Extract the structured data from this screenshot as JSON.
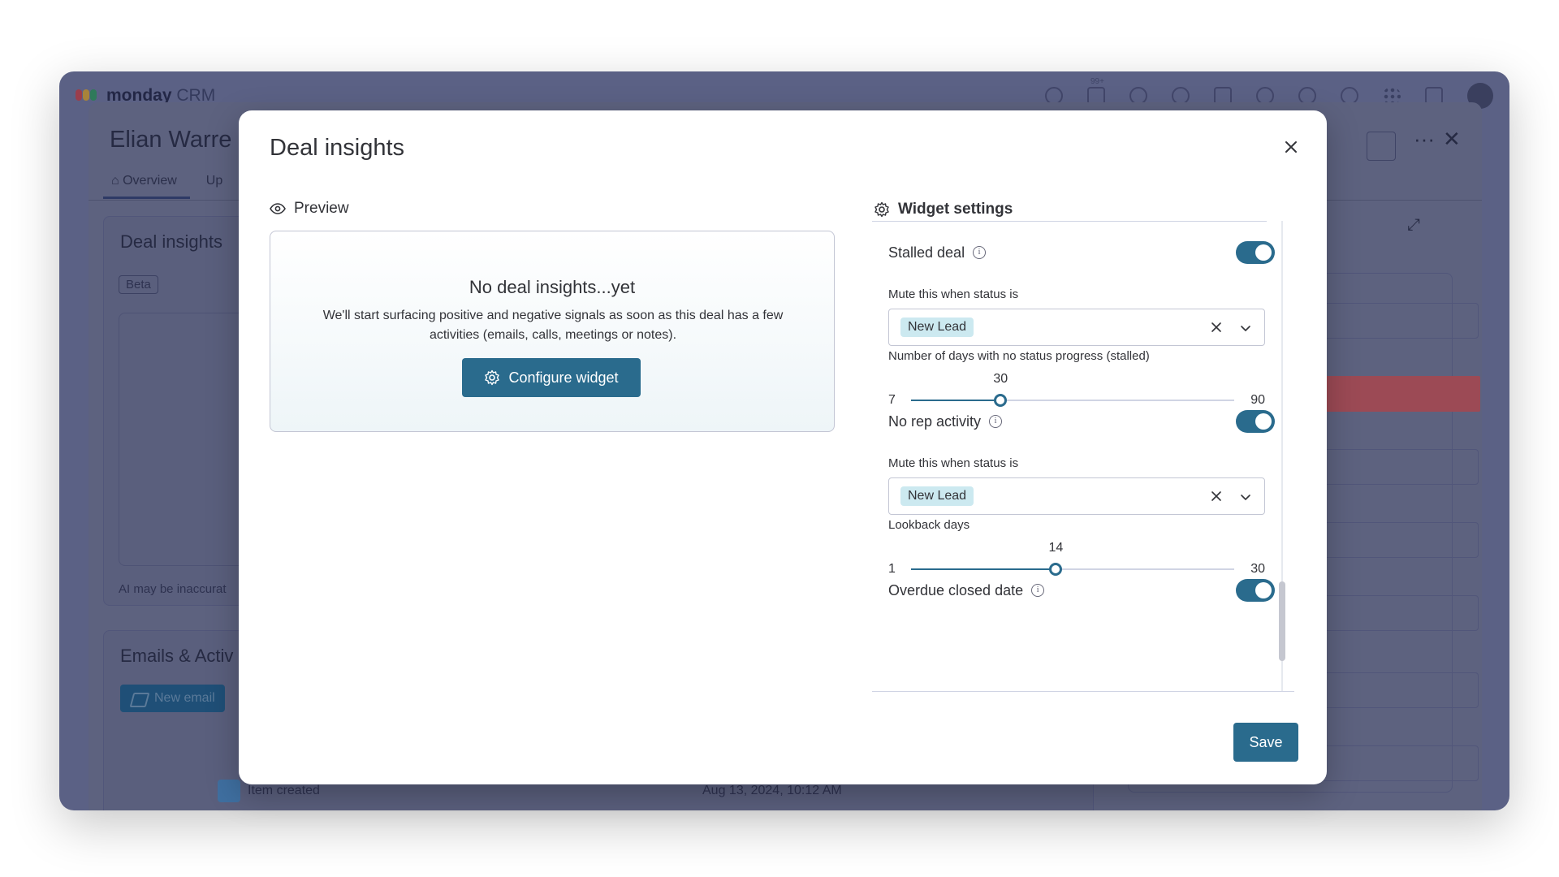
{
  "app": {
    "brand_name": "monday",
    "brand_suffix": "CRM",
    "notification_count": "99+",
    "record_title": "Elian Warre",
    "tabs": [
      {
        "label": "Overview"
      },
      {
        "label": "Up"
      }
    ],
    "deal_insights_card_title": "Deal insights",
    "beta_badge": "Beta",
    "ai_note": "AI may be inaccurat",
    "emails_card_title": "Emails & Activ",
    "new_email_label": "New email",
    "timeline_item": "Item created",
    "timeline_date": "Aug 13, 2024, 10:12 AM"
  },
  "modal": {
    "title": "Deal insights",
    "preview": {
      "heading": "Preview",
      "empty_title": "No deal insights...yet",
      "empty_body": "We'll start surfacing positive and negative signals as soon as this deal has a few activities (emails, calls, meetings or notes).",
      "configure_label": "Configure widget"
    },
    "settings": {
      "heading": "Widget settings",
      "stalled": {
        "label": "Stalled deal",
        "enabled": true,
        "mute_label": "Mute this when status is",
        "mute_value": "New Lead",
        "days_label": "Number of days with no status progress (stalled)",
        "min": "7",
        "max": "90",
        "value": "30"
      },
      "no_rep": {
        "label": "No rep activity",
        "enabled": true,
        "mute_label": "Mute this when status is",
        "mute_value": "New Lead",
        "days_label": "Lookback days",
        "min": "1",
        "max": "30",
        "value": "14"
      },
      "overdue": {
        "label": "Overdue closed date",
        "enabled": true
      }
    },
    "save_label": "Save"
  },
  "colors": {
    "primary": "#2a6b8d",
    "chip": "#cce9f0",
    "overlay": "#5b6185"
  }
}
